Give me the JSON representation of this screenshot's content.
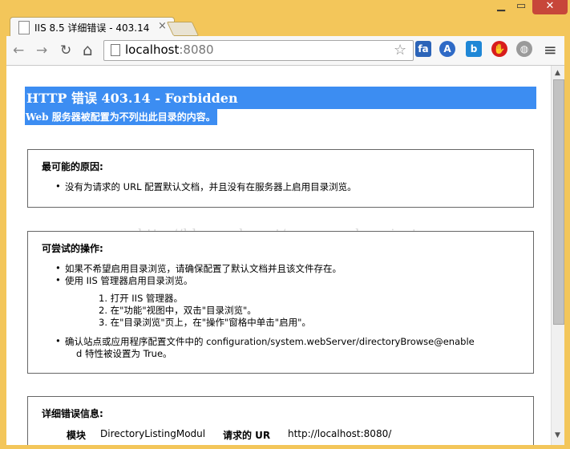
{
  "browser": {
    "tab_title": "IIS 8.5 详细错误 - 403.14",
    "tab_close": "×",
    "window_minimize": "▁",
    "window_maximize": "▭",
    "window_close": "✕",
    "url_host": "localhost",
    "url_port": ":8080",
    "back_icon": "←",
    "forward_icon": "→",
    "reload_icon": "↻",
    "home_icon": "⌂",
    "star_icon": "☆",
    "menu_icon": "≡"
  },
  "error": {
    "title": "HTTP 错误 403.14 - Forbidden",
    "subtitle": "Web 服务器被配置为不列出此目录的内容。"
  },
  "cause_box": {
    "heading": "最可能的原因:",
    "items": [
      "没有为请求的 URL 配置默认文档，并且没有在服务器上启用目录浏览。"
    ]
  },
  "actions_box": {
    "heading": "可尝试的操作:",
    "items": [
      "如果不希望启用目录浏览，请确保配置了默认文档并且该文件存在。",
      "使用 IIS 管理器启用目录浏览。"
    ],
    "steps": [
      "1.  打开 IIS 管理器。",
      "2.  在\"功能\"视图中，双击\"目录浏览\"。",
      "3.  在\"目录浏览\"页上，在\"操作\"窗格中单击\"启用\"。"
    ],
    "last_item_line1": "确认站点或应用程序配置文件中的 configuration/system.webServer/directoryBrowse@enable",
    "last_item_line2": "d 特性被设置为 True。"
  },
  "detail_box": {
    "heading": "详细错误信息:",
    "module_label": "模块",
    "module_value": "DirectoryListingModul",
    "url_label": "请求的 UR",
    "url_value": "http://localhost:8080/"
  },
  "watermark": "http://blog.csdn.net/yuanguozhengjust"
}
